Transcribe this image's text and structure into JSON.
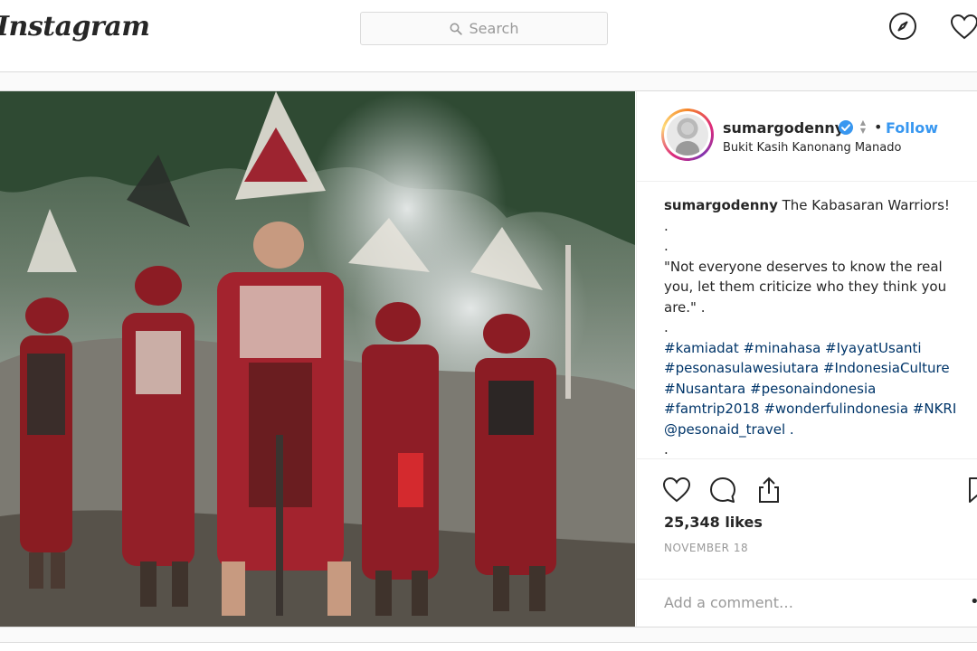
{
  "header": {
    "logo_text": "Instagram",
    "search_placeholder": "Search",
    "icons": [
      "search-icon",
      "compass-icon",
      "heart-icon"
    ]
  },
  "post": {
    "username": "sumargodenny",
    "verified": true,
    "follow_label": "Follow",
    "location": "Bukit Kasih Kanonang Manado",
    "caption": {
      "user": "sumargodenny",
      "title": "The Kabasaran Warriors!",
      "dot1": ".",
      "dot2": ".",
      "quote": "\"Not everyone deserves to know the real you, let them criticize who they think you are.\" .",
      "dot3": ".",
      "hashtags": "#kamiadat #minahasa #IyayatUsanti #pesonasulawesiutara #IndonesiaCulture #Nusantara #pesonaindonesia #famtrip2018 #wonderfulindonesia #NKRI @pesonaid_travel .",
      "dot4": "."
    },
    "likes": "25,348 likes",
    "date": "NOVEMBER 18",
    "comment_placeholder": "Add a comment…",
    "more_label": "•",
    "action_icons": [
      "heart-icon",
      "comment-icon",
      "share-icon",
      "bookmark-icon"
    ]
  },
  "colors": {
    "link_blue": "#3897f0",
    "hashtag": "#003569",
    "border": "#dbdbdb",
    "muted": "#999999"
  }
}
